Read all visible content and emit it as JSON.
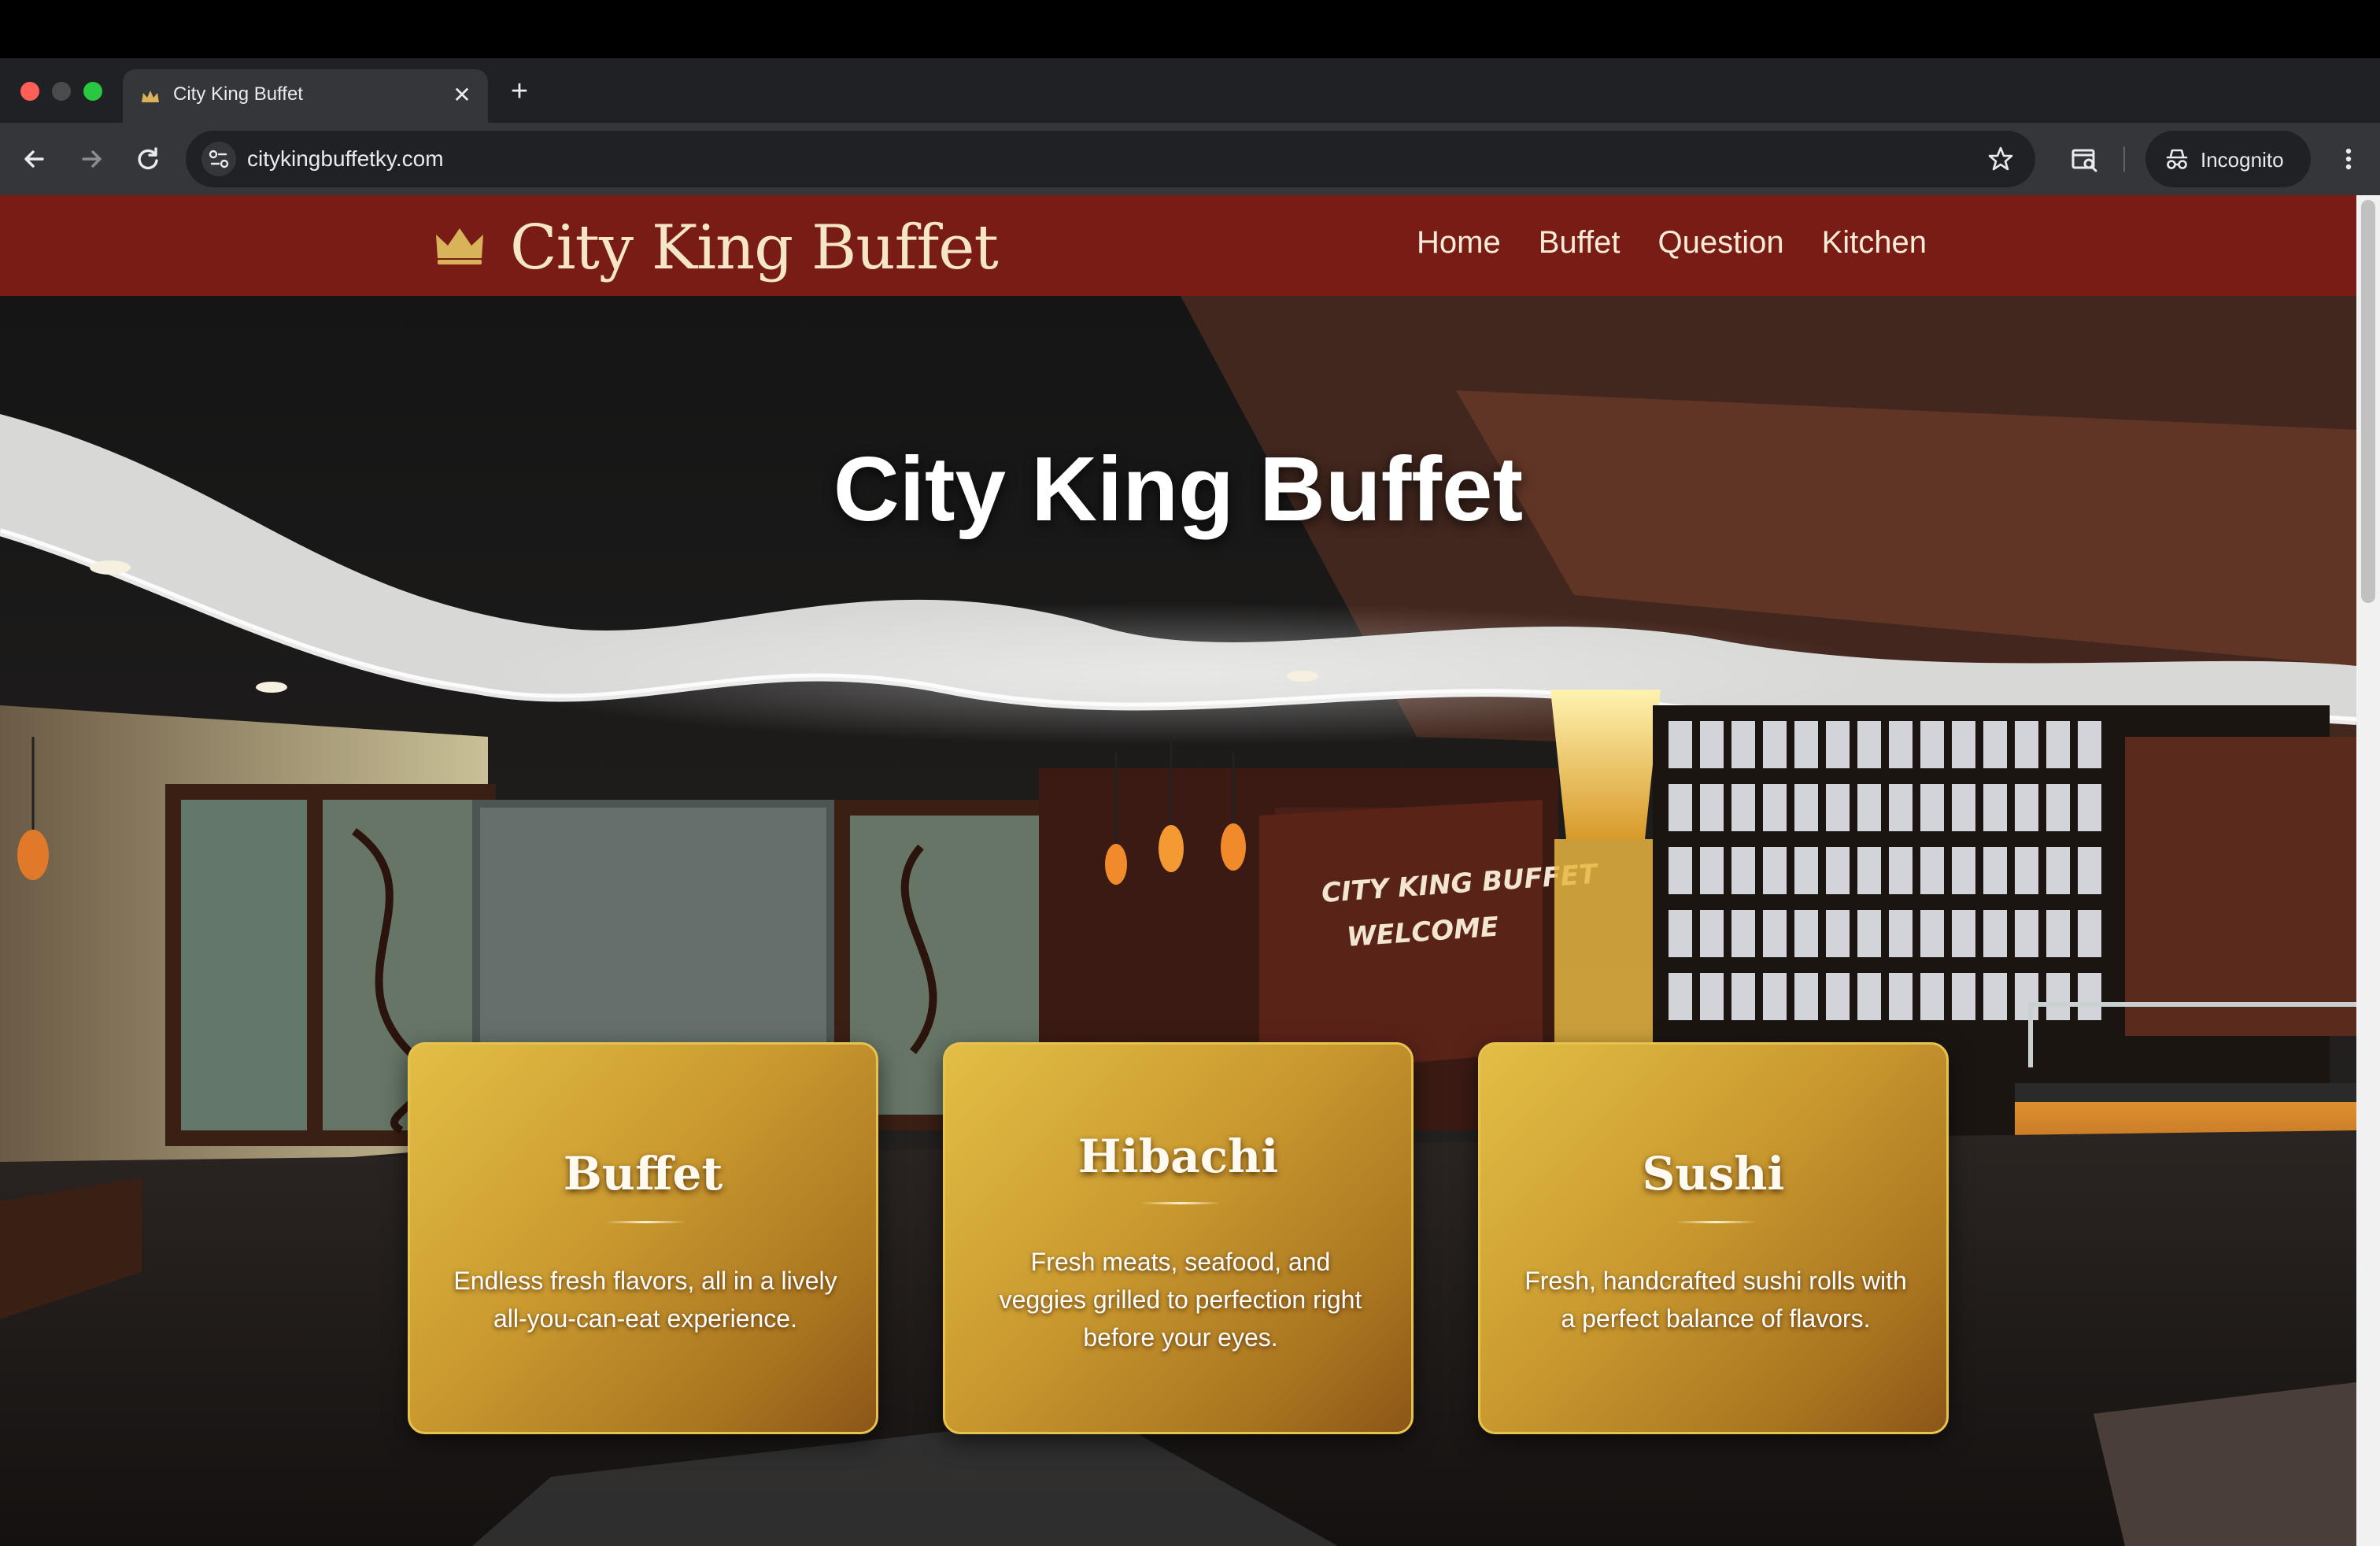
{
  "browser": {
    "tab_title": "City King Buffet",
    "url": "citykingbuffetky.com",
    "profile_label": "Incognito"
  },
  "site": {
    "logo_text": "City King Buffet",
    "nav": [
      "Home",
      "Buffet",
      "Question",
      "Kitchen"
    ],
    "hero_title": "City King Buffet",
    "wall_sign_line1": "CITY KING BUFFET",
    "wall_sign_line2": "WELCOME",
    "cards": [
      {
        "title": "Buffet",
        "description": "Endless fresh flavors, all in a lively all-you-can-eat experience."
      },
      {
        "title": "Hibachi",
        "description": "Fresh meats, seafood, and veggies grilled to perfection right before your eyes."
      },
      {
        "title": "Sushi",
        "description": "Fresh, handcrafted sushi rolls with a perfect balance of flavors."
      }
    ]
  },
  "colors": {
    "header_bg": "#7a1c16",
    "logo_gold": "#d9b35a",
    "card_gold": "#d4a93a",
    "card_border": "#e6c34e"
  },
  "icons": {
    "back": "arrow-left-icon",
    "forward": "arrow-right-icon",
    "reload": "reload-icon",
    "site_info": "tune-icon",
    "bookmark": "star-icon",
    "tab_search": "tab-search-icon",
    "incognito": "incognito-icon",
    "menu": "kebab-menu-icon",
    "logo": "crown-icon"
  }
}
